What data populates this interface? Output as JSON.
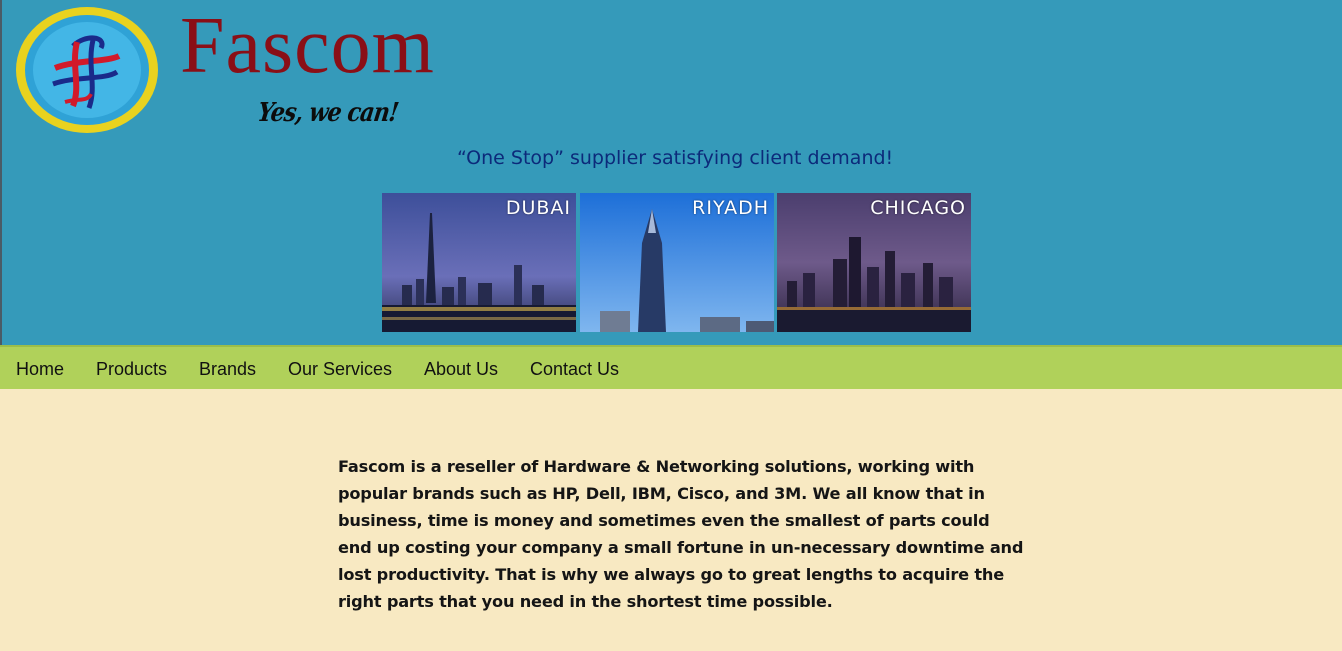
{
  "header": {
    "brand_name": "Fascom",
    "tagline": "Yes, we can!",
    "slogan": "“One Stop” supplier satisfying client demand!",
    "cities": [
      {
        "label": "DUBAI"
      },
      {
        "label": "RIYADH"
      },
      {
        "label": "CHICAGO"
      }
    ]
  },
  "nav": {
    "items": [
      {
        "label": "Home"
      },
      {
        "label": "Products"
      },
      {
        "label": "Brands"
      },
      {
        "label": "Our Services"
      },
      {
        "label": "About Us"
      },
      {
        "label": "Contact Us"
      }
    ]
  },
  "main": {
    "intro": "Fascom is a reseller of Hardware & Networking solutions, working with popular brands such as HP, Dell, IBM, Cisco, and 3M. We all know that in business, time is money and sometimes even the smallest of parts could end up costing your company a small fortune in un-necessary downtime and lost productivity. That is why we always go to great lengths to acquire the right parts that you need in the shortest time possible."
  },
  "colors": {
    "header_bg": "#359aba",
    "nav_bg": "#b0d15a",
    "page_bg": "#f8e9c2",
    "brand": "#8a0f17",
    "slogan": "#0c2a7a"
  }
}
